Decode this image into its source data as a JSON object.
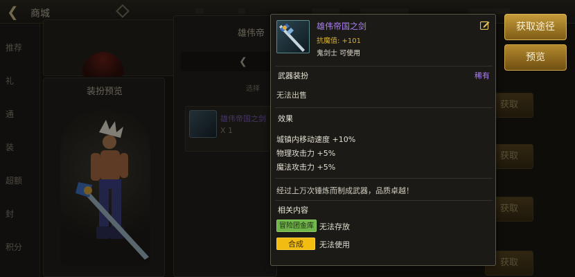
{
  "background": {
    "topbar": {
      "back_icon": "back-arrow-icon",
      "title": "商城",
      "subtitle": "",
      "currency_icon": "diamond-icon"
    },
    "sidebar": {
      "items": [
        "推荐",
        "礼",
        "通",
        "装",
        "超额",
        "封",
        "积分"
      ]
    },
    "preview_panel": {
      "title": "装扮预览"
    },
    "top_card": {
      "text": ""
    },
    "middle_panel": {
      "title": "雄伟帝",
      "hint": "选择",
      "item": {
        "name": "雄伟帝国之剑",
        "quantity": "X 1"
      }
    },
    "right_list": {
      "button_label": "获取"
    }
  },
  "tooltip": {
    "item_name": "雄伟帝国之剑",
    "stat": "抗魔值: +101",
    "class_restriction": "鬼剑士 可使用",
    "category": "武器装扮",
    "rarity": "稀有",
    "trade_note": "无法出售",
    "effects_title": "效果",
    "effects": [
      "城镇内移动速度 +10%",
      "物理攻击力 +5%",
      "魔法攻击力 +5%"
    ],
    "description": "经过上万次锤炼而制成武器，品质卓越！",
    "related_title": "相关内容",
    "related": [
      {
        "tag": "冒险团金库",
        "note": "无法存放"
      },
      {
        "tag": "合成",
        "note": "无法使用"
      }
    ]
  },
  "actions": {
    "get_label": "获取途径",
    "preview_label": "预览"
  },
  "colors": {
    "rarity_purple": "#a97ff0",
    "stat_gold": "#d5b12f",
    "tag_green": "#6fb34a",
    "tag_yellow": "#f2bd10",
    "button_gold": "#c59a3a"
  }
}
